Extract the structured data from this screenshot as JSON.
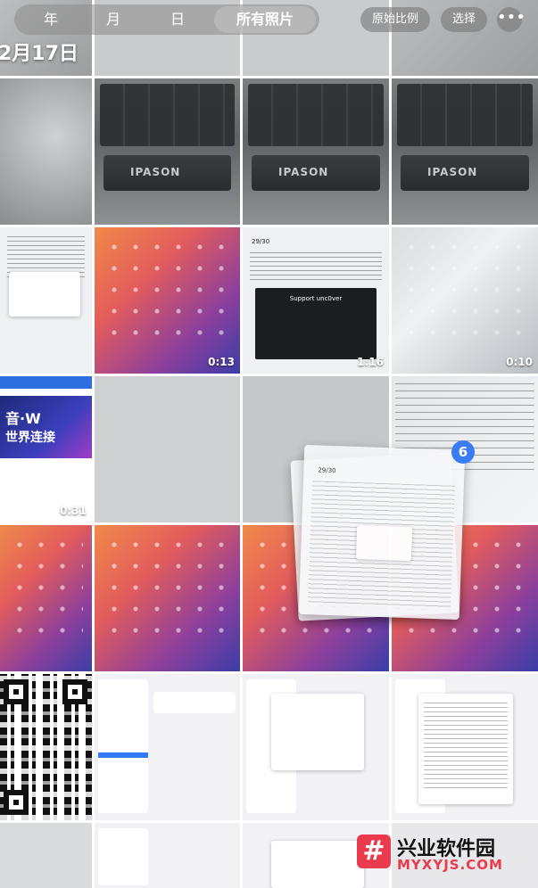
{
  "topbar": {
    "segments": [
      "年",
      "月",
      "日",
      "所有照片"
    ],
    "active_segment": "所有照片",
    "aspect_button": "原始比例",
    "select_button": "选择",
    "more_button": "•••"
  },
  "date_header": "2月17日",
  "photos": {
    "durations": {
      "video1": "0:13",
      "video2": "1:16",
      "video3": "0:10",
      "video4": "0:31"
    },
    "keyboard_brand": "IPASON",
    "terminal_title": "Support unc0ver",
    "terminal_counter": "29/30",
    "web_banner_line1": "音·W",
    "web_banner_line2": "世界连接"
  },
  "drag": {
    "count": "6",
    "card_title": "29/30"
  },
  "watermark": {
    "title": "兴业软件园",
    "subtitle": "MYXYJS.COM",
    "icon_glyph": "#"
  },
  "colors": {
    "accent": "#3a7bf6",
    "watermark": "#ea3b4e"
  }
}
